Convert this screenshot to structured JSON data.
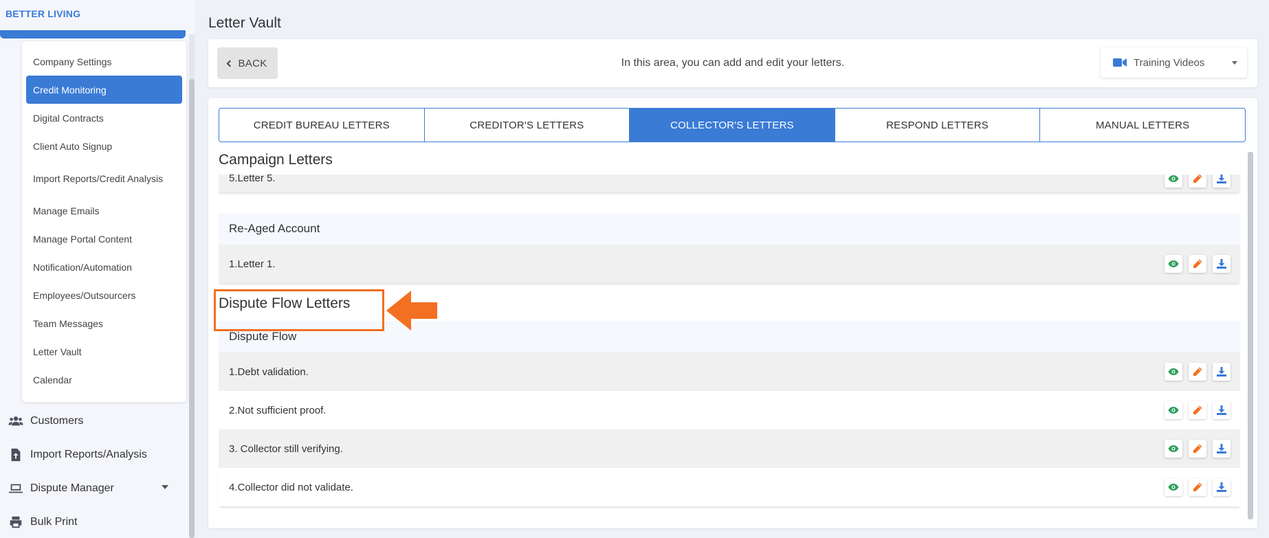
{
  "brand": "BETTER LIVING",
  "sidebar": {
    "submenu": [
      {
        "label": "Company Settings",
        "active": false
      },
      {
        "label": "Credit Monitoring",
        "active": true
      },
      {
        "label": "Digital Contracts",
        "active": false
      },
      {
        "label": "Client Auto Signup",
        "active": false
      },
      {
        "label": "Import Reports/Credit Analysis",
        "active": false
      },
      {
        "label": "Manage Emails",
        "active": false
      },
      {
        "label": "Manage Portal Content",
        "active": false
      },
      {
        "label": "Notification/Automation",
        "active": false
      },
      {
        "label": "Employees/Outsourcers",
        "active": false
      },
      {
        "label": "Team Messages",
        "active": false
      },
      {
        "label": "Letter Vault",
        "active": false
      },
      {
        "label": "Calendar",
        "active": false
      }
    ],
    "nav": [
      {
        "label": "Customers",
        "icon": "users-icon"
      },
      {
        "label": "Import Reports/Analysis",
        "icon": "file-upload-icon"
      },
      {
        "label": "Dispute Manager",
        "icon": "laptop-icon"
      },
      {
        "label": "Bulk Print",
        "icon": "printer-icon"
      }
    ]
  },
  "page": {
    "title": "Letter Vault",
    "back_label": "BACK",
    "info": "In this area, you can add and edit your letters.",
    "training_label": "Training Videos"
  },
  "tabs": [
    {
      "label": "CREDIT BUREAU LETTERS",
      "active": false
    },
    {
      "label": "CREDITOR'S LETTERS",
      "active": false
    },
    {
      "label": "COLLECTOR'S LETTERS",
      "active": true
    },
    {
      "label": "RESPOND LETTERS",
      "active": false
    },
    {
      "label": "MANUAL LETTERS",
      "active": false
    }
  ],
  "sections": {
    "campaign": {
      "title": "Campaign Letters",
      "partial_row": "5.Letter 5.",
      "group": "Re-Aged Account",
      "rows": [
        "1.Letter 1."
      ]
    },
    "dispute": {
      "title": "Dispute Flow Letters",
      "group": "Dispute Flow",
      "rows": [
        "1.Debt validation.",
        "2.Not sufficient proof.",
        "3. Collector still verifying.",
        "4.Collector did not validate."
      ]
    }
  },
  "colors": {
    "accent": "#3a7bd5",
    "highlight": "#f36f21",
    "view": "#2e9e5b",
    "edit": "#f36f21",
    "download": "#3a7bd5"
  }
}
